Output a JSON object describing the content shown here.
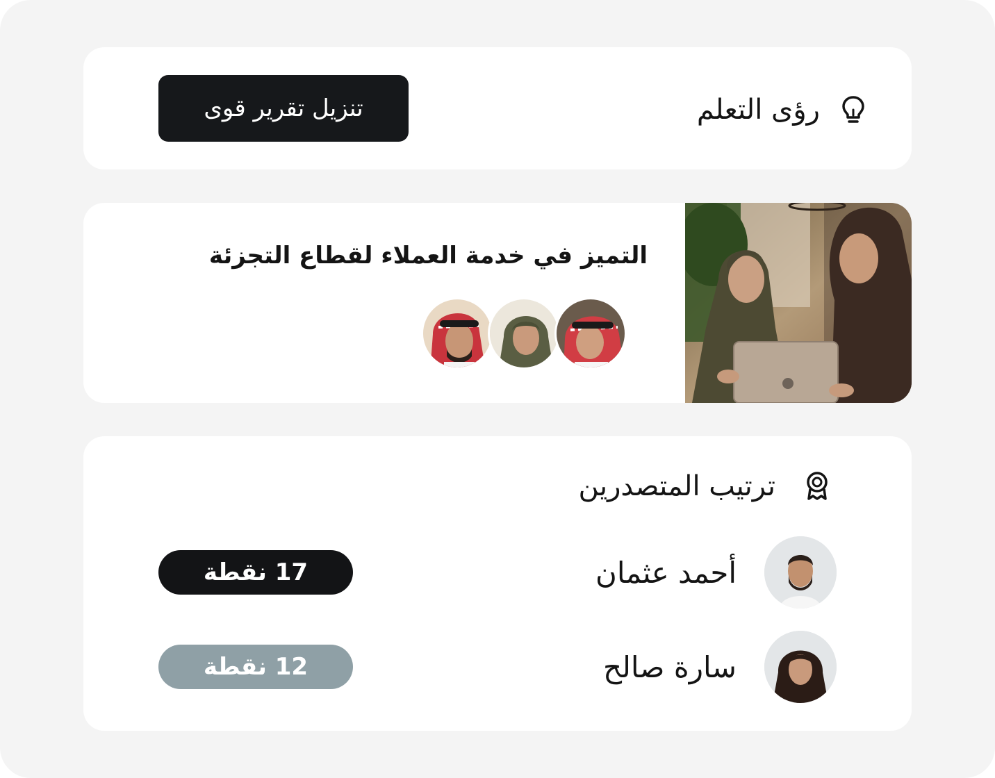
{
  "insights": {
    "title": "رؤى التعلم",
    "icon": "lightbulb-icon",
    "download_button": "تنزيل تقرير قوى"
  },
  "course": {
    "title": "التميز في خدمة العملاء لقطاع التجزئة",
    "photo": "course-photo-two-women-laptop",
    "learner_avatars": [
      "learner-avatar-1",
      "learner-avatar-2",
      "learner-avatar-3"
    ]
  },
  "leaderboard": {
    "title": "ترتيب المتصدرين",
    "icon": "award-icon",
    "entries": [
      {
        "name": "أحمد عثمان",
        "points": "17 نقطة",
        "badge_color": "#131416"
      },
      {
        "name": "سارة صالح",
        "points": "12 نقطة",
        "badge_color": "#8fa0a6"
      }
    ]
  },
  "colors": {
    "background": "#f4f4f4",
    "card": "#ffffff",
    "dark": "#16181b",
    "muted_badge": "#8fa0a6"
  }
}
